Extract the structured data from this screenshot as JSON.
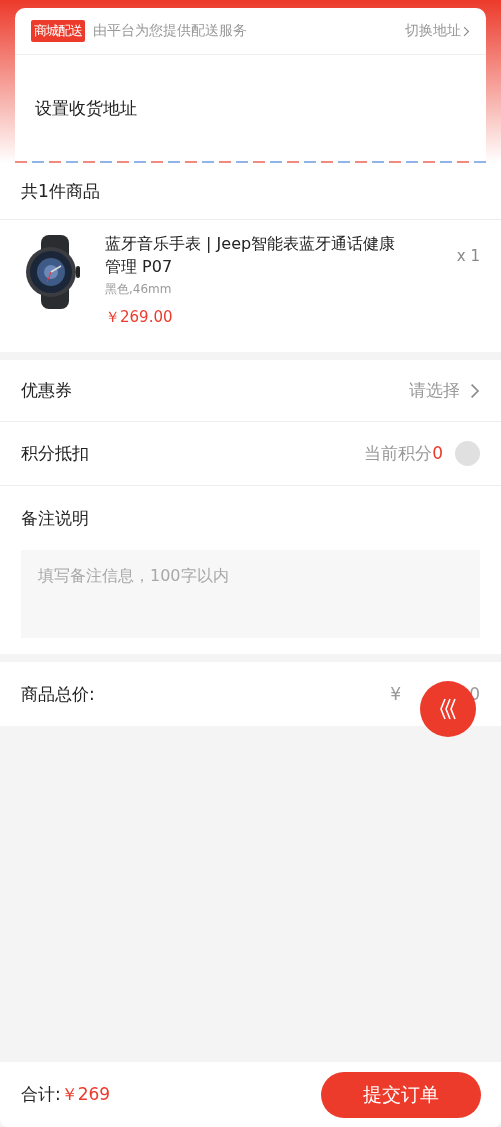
{
  "delivery": {
    "tag": "商城配送",
    "description": "由平台为您提供配送服务",
    "switch_link": "切换地址"
  },
  "address": {
    "prompt": "设置收货地址"
  },
  "goods": {
    "count_title": "共1件商品",
    "items": [
      {
        "kind": "picture",
        "name": "蓝牙音乐手表 | Jeep智能表蓝牙通话健康管理 P07",
        "spec": "黑色,46mm",
        "price": "￥269.00",
        "quantity": "x 1"
      }
    ]
  },
  "coupon": {
    "label": "优惠券",
    "value": "请选择"
  },
  "points": {
    "label": "积分抵扣",
    "caption": "当前积分",
    "amount": "0",
    "on": false
  },
  "remarks": {
    "label": "备注说明",
    "placeholder": "填写备注信息，100字以内"
  },
  "total": {
    "label": "商品总价:",
    "price_start": "¥",
    "price_end": "0"
  },
  "footer": {
    "sum_label": "合计:",
    "sum_value": "￥269",
    "submit": "提交订单"
  }
}
